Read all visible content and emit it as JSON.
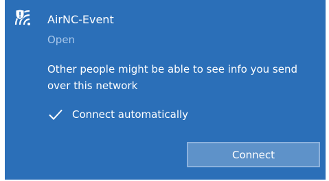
{
  "network": {
    "name": "AirNC-Event",
    "status": "Open",
    "icon": "wifi-shield-warning-icon"
  },
  "warning_text": "Other people might be able to see info you send over this network",
  "auto_connect": {
    "label": "Connect automatically",
    "checked": true,
    "icon": "checkmark-icon"
  },
  "actions": {
    "connect_label": "Connect"
  },
  "colors": {
    "panel_background": "#2b6fb8",
    "status_text": "#a9c8eb",
    "button_background": "#5e92c9",
    "button_border": "#8cb2dd"
  }
}
